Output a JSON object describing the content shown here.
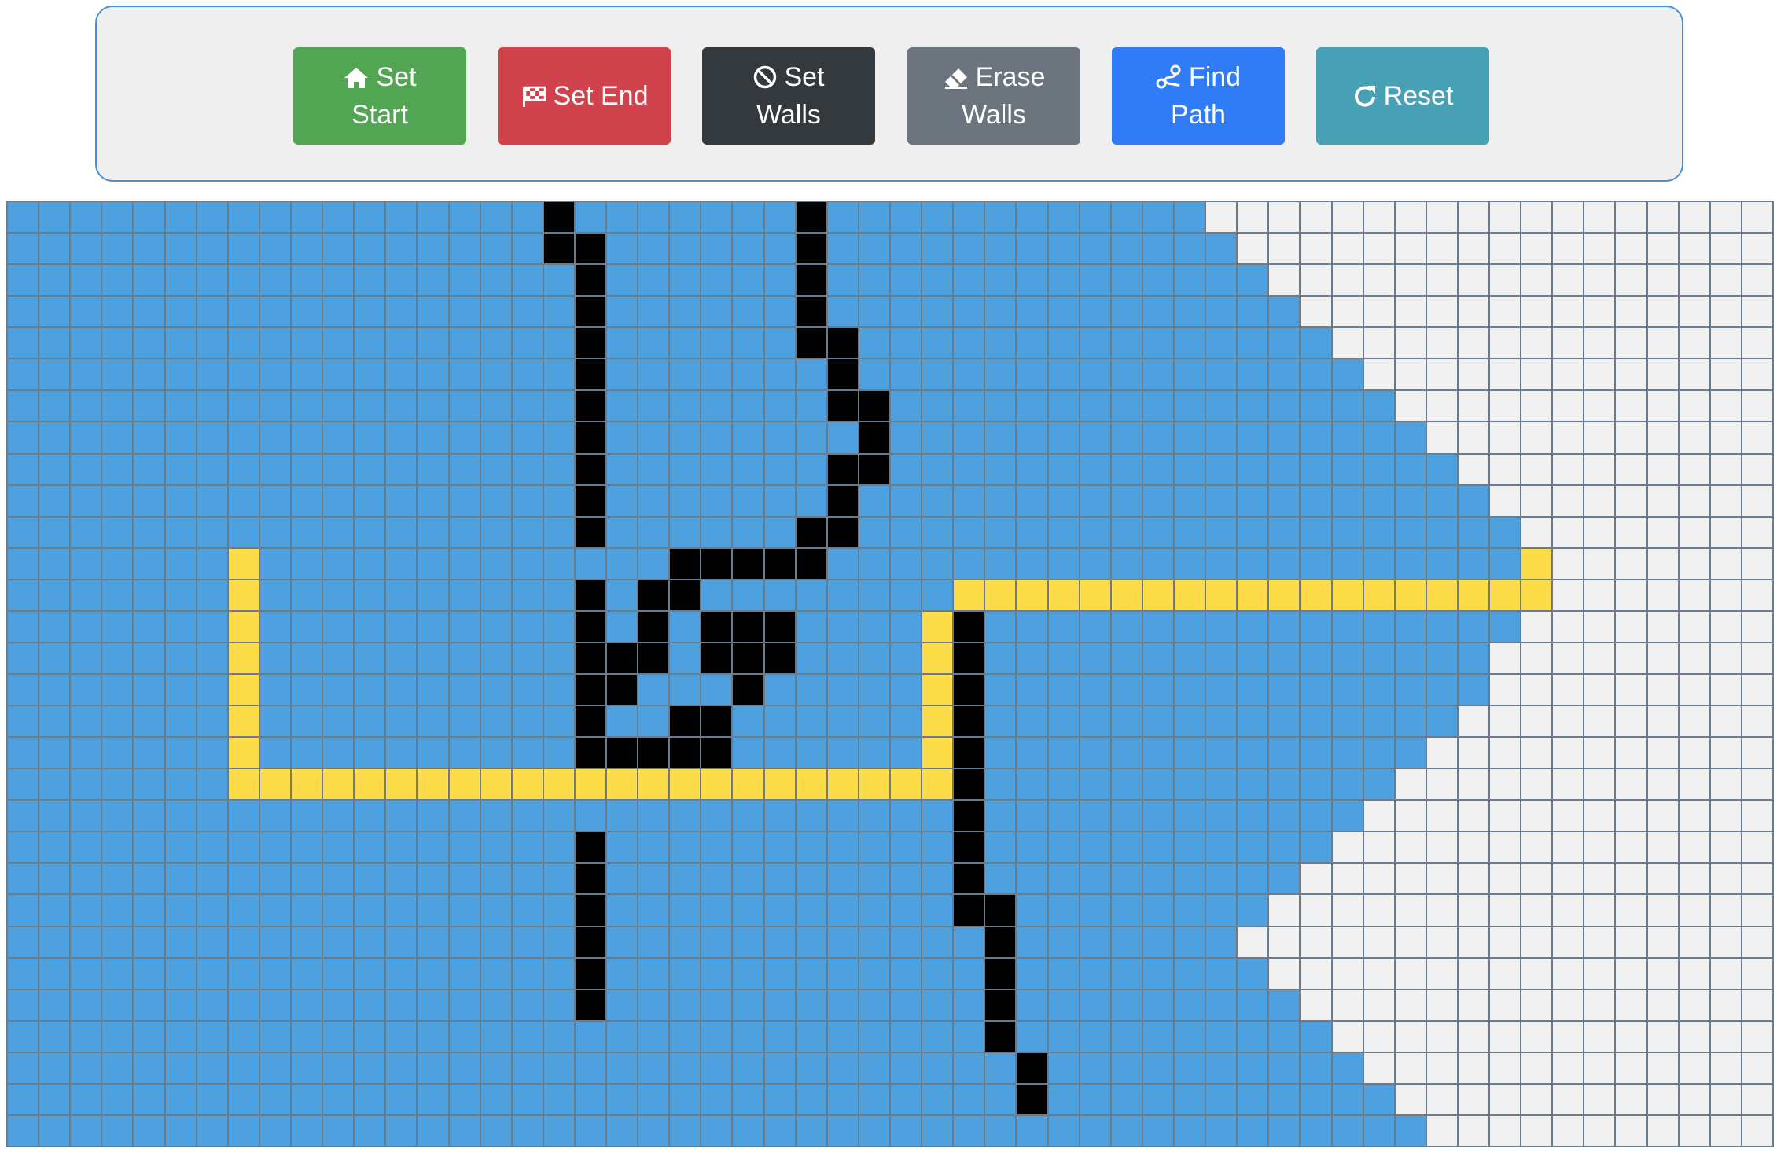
{
  "toolbar": {
    "buttons": [
      {
        "id": "set-start",
        "line1": "Set",
        "line2": "Start",
        "icon": "home-icon",
        "color": "#52a552"
      },
      {
        "id": "set-end",
        "line1": "Set End",
        "line2": "",
        "icon": "flag-checkered-icon",
        "color": "#d0434d"
      },
      {
        "id": "set-walls",
        "line1": "Set",
        "line2": "Walls",
        "icon": "ban-icon",
        "color": "#34393e"
      },
      {
        "id": "erase-walls",
        "line1": "Erase",
        "line2": "Walls",
        "icon": "eraser-icon",
        "color": "#6c757d"
      },
      {
        "id": "find-path",
        "line1": "Find",
        "line2": "Path",
        "icon": "route-icon",
        "color": "#2f7cf6"
      },
      {
        "id": "reset",
        "line1": "Reset",
        "line2": "",
        "icon": "redo-icon",
        "color": "#48a0b4"
      }
    ]
  },
  "grid": {
    "cols": 56,
    "rows": 30,
    "colors": {
      "empty": "#f0f0f0",
      "visited": "#4ea0de",
      "wall": "#000000",
      "path": "#fddc4a",
      "grid_line": "#6b7b89"
    },
    "legend": {
      "e": "empty",
      "v": "visited",
      "w": "wall",
      "p": "path"
    },
    "cells": [
      "vvvvvvvvvvvvvvvvvwvvvvvvvwvvvvvvvvvvvveeeeeeeeeeeeeeeeee",
      "vvvvvvvvvvvvvvvvvwwvvvvvvwvvvvvvvvvvvvveeeeeeeeeeeeeeeee",
      "vvvvvvvvvvvvvvvvvvwvvvvvvwvvvvvvvvvvvvvveeeeeeeeeeeeeeee",
      "vvvvvvvvvvvvvvvvvvwvvvvvvwvvvvvvvvvvvvvvveeeeeeeeeeeeeee",
      "vvvvvvvvvvvvvvvvvvwvvvvvvwwvvvvvvvvvvvvvvveeeeeeeeeeeeee",
      "vvvvvvvvvvvvvvvvvvwvvvvvvvwvvvvvvvvvvvvvvvveeeeeeeeeeeee",
      "vvvvvvvvvvvvvvvvvvwvvvvvvvwwvvvvvvvvvvvvvvvveeeeeeeeeeee",
      "vvvvvvvvvvvvvvvvvvwvvvvvvvvwvvvvvvvvvvvvvvvvveeeeeeeeeee",
      "vvvvvvvvvvvvvvvvvvwvvvvvvvwwvvvvvvvvvvvvvvvvvveeeeeeeeee",
      "vvvvvvvvvvvvvvvvvvwvvvvvvvwvvvvvvvvvvvvvvvvvvvveeeeeeeee",
      "vvvvvvvvvvvvvvvvvvwvvvvvvwwvvvvvvvvvvvvvvvvvvvvveeeeeeee",
      "vvvvvvvpvvvvvvvvvvvvvwwwwwvvvvvvvvvvvvvvvvvvvvvvpeeeeeee",
      "vvvvvvvpvvvvvvvvvvwvwwvvvvvvvvpppppppppppppppppppeeeeeee",
      "vvvvvvvpvvvvvvvvvvwvwvwwwvvvvpwvvvvvvvvvvvvvvvvveeeeeeee",
      "vvvvvvvpvvvvvvvvvvwwwvwwwvvvvpwvvvvvvvvvvvvvvvveeeeeeeee",
      "vvvvvvvpvvvvvvvvvvwwvvvwvvvvvpwvvvvvvvvvvvvvvvveeeeeeeee",
      "vvvvvvvpvvvvvvvvvvwvvwwvvvvvvpwvvvvvvvvvvvvvvveeeeeeeeee",
      "vvvvvvvpvvvvvvvvvvwwwwwvvvvvvpwvvvvvvvvvvvvvveeeeeeeeeee",
      "vvvvvvvpppppppppppppppppppppppwvvvvvvvvvvvvveeeeeeeeeeee",
      "vvvvvvvvvvvvvvvvvvvvvvvvvvvvvvwvvvvvvvvvvvveeeeeeeeeeeee",
      "vvvvvvvvvvvvvvvvvvwvvvvvvvvvvvwvvvvvvvvvvveeeeeeeeeeeeee",
      "vvvvvvvvvvvvvvvvvvwvvvvvvvvvvvwvvvvvvvvvveeeeeeeeeeeeeee",
      "vvvvvvvvvvvvvvvvvvwvvvvvvvvvvvwwvvvvvvvveeeeeeeeeeeeeeee",
      "vvvvvvvvvvvvvvvvvvwvvvvvvvvvvvvwvvvvvvveeeeeeeeeeeeeeeee",
      "vvvvvvvvvvvvvvvvvvwvvvvvvvvvvvvwvvvvvvvveeeeeeeeeeeeeeee",
      "vvvvvvvvvvvvvvvvvvwvvvvvvvvvvvvwvvvvvvvvveeeeeeeeeeeeeee",
      "vvvvvvvvvvvvvvvvvvvvvvvvvvvvvvvwvvvvvvvvvveeeeeeeeeeeeee",
      "vvvvvvvvvvvvvvvvvvvvvvvvvvvvvvvvwvvvvvvvvvveeeeeeeeeeeee",
      "vvvvvvvvvvvvvvvvvvvvvvvvvvvvvvvvwvvvvvvvvvvveeeeeeeeeeee",
      "vvvvvvvvvvvvvvvvvvvvvvvvvvvvvvvvvvvvvvvvvvvvveeeeeeeeeee"
    ]
  }
}
